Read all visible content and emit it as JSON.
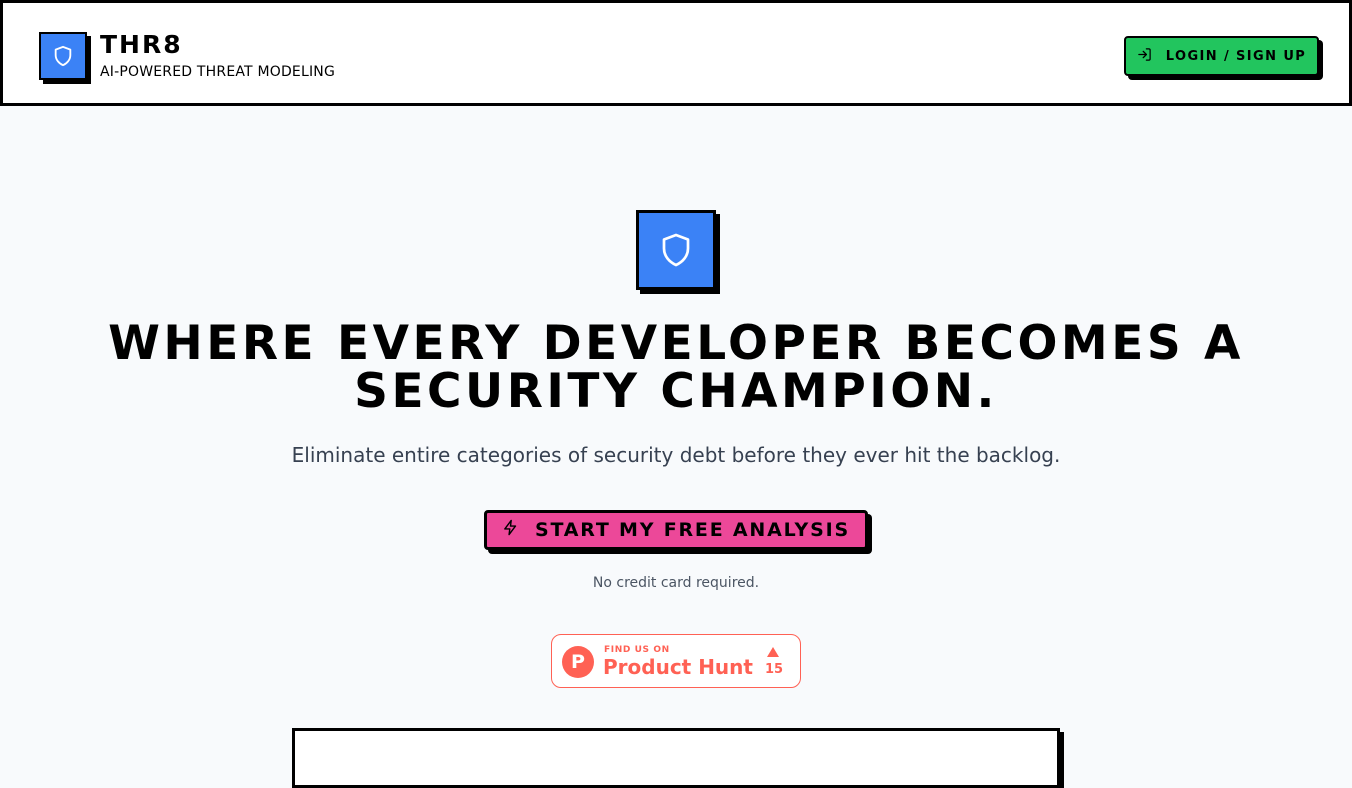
{
  "header": {
    "logo_icon": "shield-icon",
    "brand_name": "THR8",
    "tagline": "AI-POWERED THREAT MODELING",
    "login": {
      "icon": "login-icon",
      "label": "LOGIN / SIGN UP",
      "color": "#22c55e"
    }
  },
  "hero": {
    "icon": "shield-icon",
    "headline_line1": "WHERE EVERY DEVELOPER BECOMES A",
    "headline_line2": "SECURITY CHAMPION.",
    "subheadline": "Eliminate entire categories of security debt before they ever hit the backlog.",
    "cta": {
      "icon": "lightning-icon",
      "label": "START MY FREE ANALYSIS",
      "color": "#ec4899"
    },
    "note": "No credit card required."
  },
  "product_hunt": {
    "logo_letter": "P",
    "find_us": "FIND US ON",
    "name": "Product Hunt",
    "count": "15",
    "color": "#ff6154"
  },
  "colors": {
    "accent_blue": "#3b82f6",
    "background": "#f8fafc"
  }
}
